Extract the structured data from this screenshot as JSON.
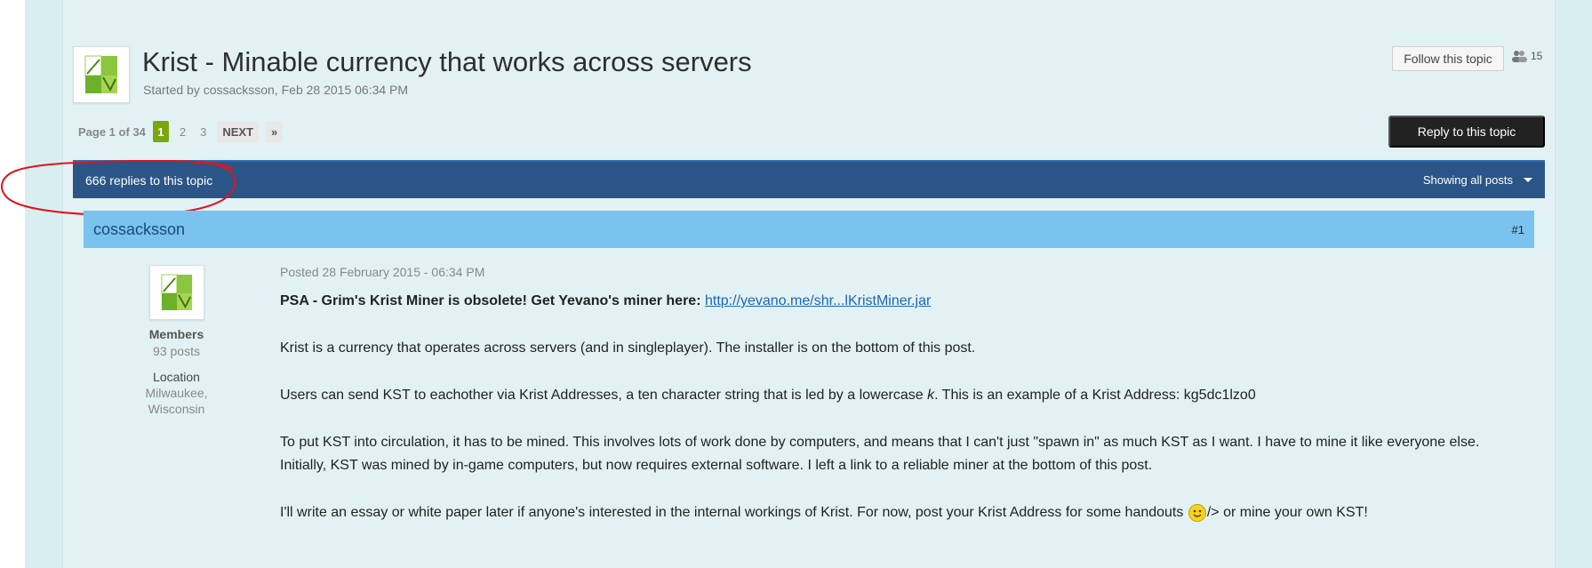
{
  "topic": {
    "title": "Krist - Minable currency that works across servers",
    "meta": "Started by cossacksson, Feb 28 2015 06:34 PM",
    "follow_label": "Follow this topic",
    "followers_count": "15",
    "reply_label": "Reply to this topic"
  },
  "pagination": {
    "info": "Page 1 of 34",
    "current": "1",
    "pages": [
      "2",
      "3"
    ],
    "next_label": "NEXT",
    "last_label": "»"
  },
  "maintitle": {
    "replies": "666 replies to this topic",
    "filter_label": "Showing all posts"
  },
  "post": {
    "author": "cossacksson",
    "number": "#1",
    "group": "Members",
    "posts": "93 posts",
    "location_label": "Location",
    "location_value_1": "Milwaukee,",
    "location_value_2": "Wisconsin",
    "date": "Posted 28 February 2015 - 06:34 PM",
    "psa_bold": "PSA - Grim's Krist Miner is obsolete! Get Yevano's miner here:",
    "psa_link": "http://yevano.me/shr...lKristMiner.jar",
    "p1": "Krist is a currency that operates across servers (and in singleplayer). The installer is on the bottom of this post.",
    "p2_a": "Users can send KST to eachother via Krist Addresses, a ten character string that is led by a lowercase ",
    "p2_k": "k",
    "p2_b": ". This is an example of a Krist Address: kg5dc1lzo0",
    "p3": "To put KST into circulation, it has to be mined. This involves lots of work done by computers, and means that I can't just \"spawn in\" as much KST as I want. I have to mine it like everyone else.",
    "p4": "Initially, KST was mined by in-game computers, but now requires external software. I left a link to a reliable miner at the bottom of this post.",
    "p5_a": "I'll write an essay or white paper later if anyone's interested in the internal workings of Krist. For now, post your Krist Address for some handouts ",
    "p5_b": "/> or mine your own KST!"
  },
  "colors": {
    "accent_green": "#7ba60d",
    "maintitle_bg": "#2a5586",
    "post_header_bg": "#7ac3ee",
    "annotation_red": "#e0141e"
  },
  "icons": [
    "krist-avatar-icon",
    "followers-icon",
    "chevron-down-icon",
    "smiley-icon"
  ]
}
